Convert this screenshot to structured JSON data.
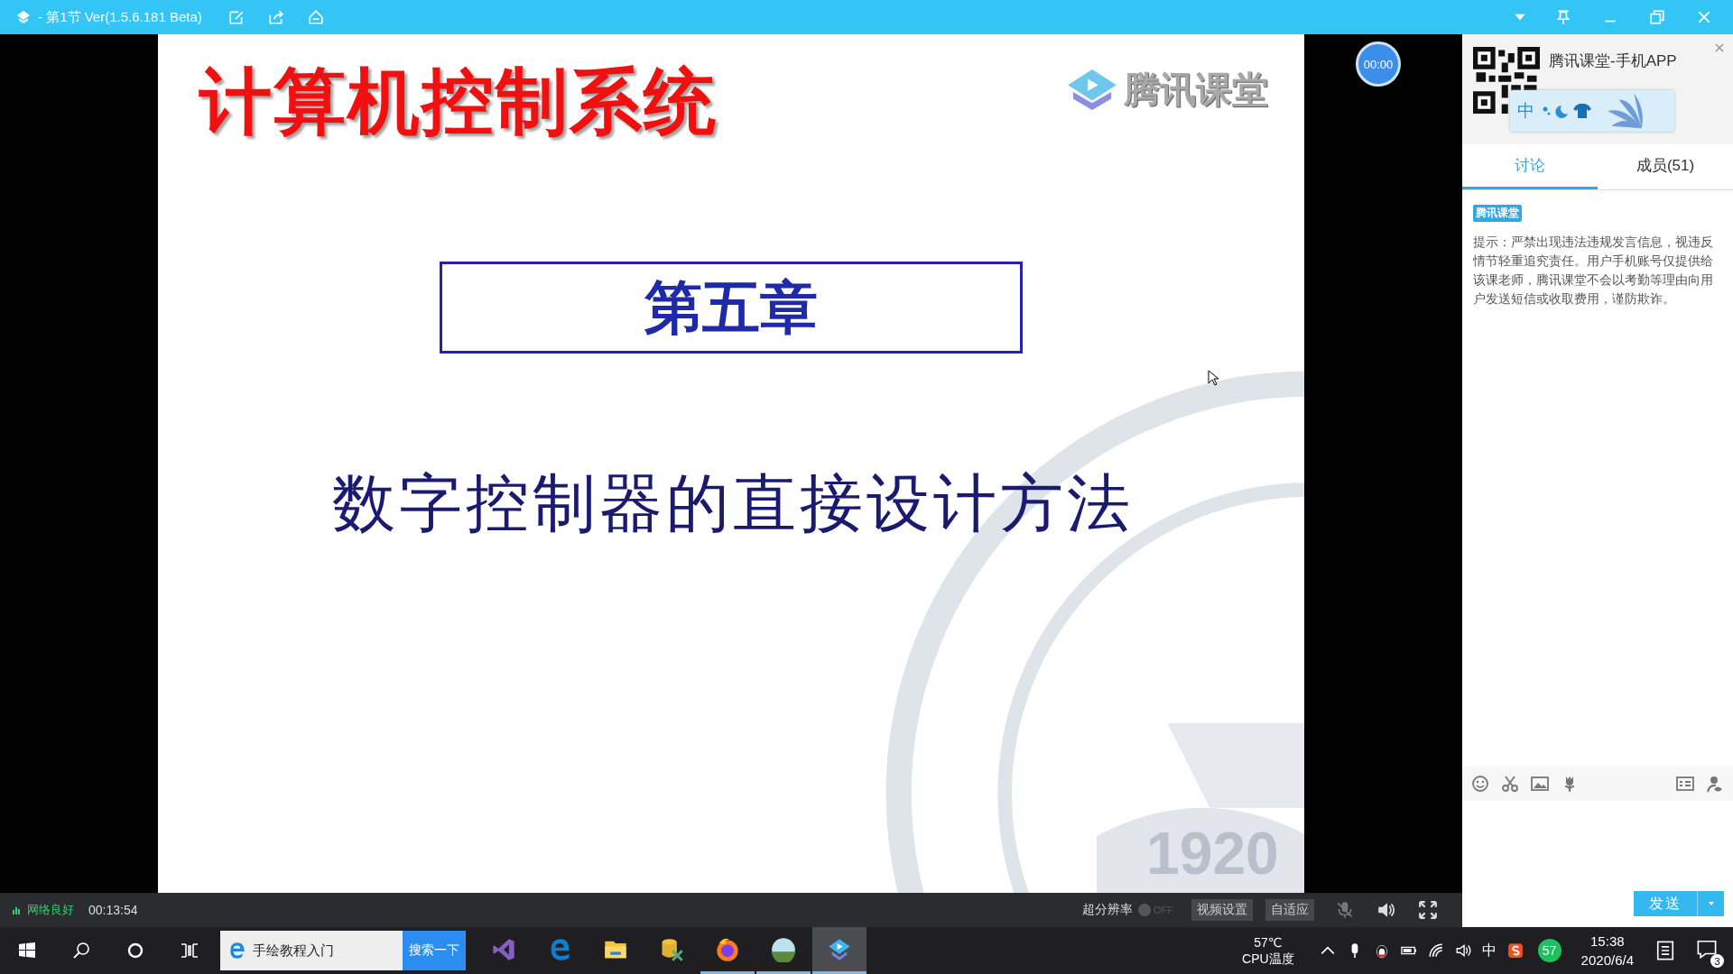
{
  "window": {
    "title": "- 第1节 Ver(1.5.6.181 Beta)"
  },
  "slide": {
    "title": "计算机控制系统",
    "logo_text": "腾讯课堂",
    "chapter": "第五章",
    "subtitle": "数字控制器的直接设计方法",
    "seal_year": "1920"
  },
  "timer": "00:00",
  "status_bar": {
    "network": "网络良好",
    "elapsed": "00:13:54",
    "super_resolution": {
      "label": "超分辨率",
      "on": false,
      "state_text": "OFF"
    },
    "buttons": [
      "视频设置",
      "自适应"
    ]
  },
  "side_panel": {
    "app_title": "腾讯课堂-手机APP",
    "ime": {
      "mode": "中"
    },
    "tabs": [
      {
        "label": "讨论",
        "selected": true
      },
      {
        "label": "成员(51)",
        "selected": false
      }
    ],
    "message": {
      "badge": "腾讯课堂",
      "text": "提示：严禁出现违法违规发言信息，视违反情节轻重追究责任。用户手机账号仅提供给该课老师，腾讯课堂不会以考勤等理由向用户发送短信或收取费用，谨防欺诈。"
    },
    "send_button": "发送"
  },
  "taskbar": {
    "search_text": "手绘教程入门",
    "search_button": "搜索一下",
    "apps": [
      {
        "kind": "vs",
        "running": false,
        "selected": false
      },
      {
        "kind": "edge",
        "running": false,
        "selected": false
      },
      {
        "kind": "folder",
        "running": false,
        "selected": false
      },
      {
        "kind": "tool",
        "running": false,
        "selected": false
      },
      {
        "kind": "firefox",
        "running": true,
        "selected": false
      },
      {
        "kind": "photo",
        "running": true,
        "selected": false
      },
      {
        "kind": "classroom",
        "running": true,
        "selected": true
      }
    ],
    "temperature": "57℃",
    "temperature_label": "CPU温度",
    "ime": "中",
    "badge_number": "57",
    "time": "15:38",
    "date": "2020/6/4",
    "notifications": "3"
  }
}
